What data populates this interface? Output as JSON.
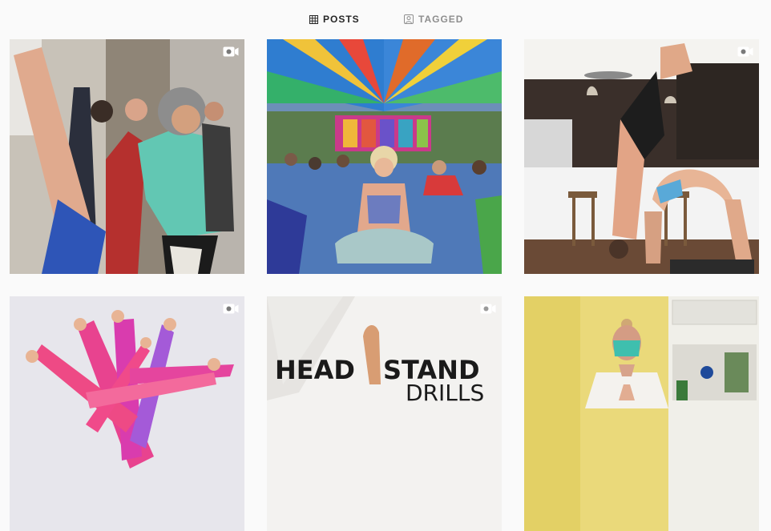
{
  "tabs": {
    "posts": {
      "label": "POSTS",
      "icon": "grid-icon",
      "active": true
    },
    "tagged": {
      "label": "TAGGED",
      "icon": "tagged-person-icon",
      "active": false
    }
  },
  "posts": [
    {
      "type": "video",
      "subject": "yoga class, older teacher assisting a student"
    },
    {
      "type": "image",
      "subject": "meditation under colorful tent"
    },
    {
      "type": "video",
      "subject": "handstand and backbend in a kitchen"
    },
    {
      "type": "video",
      "subject": "pink leggings legs in a pose"
    },
    {
      "type": "video",
      "subject": "headstand drills",
      "caption_line1": "HEAD",
      "caption_line2": "STAND",
      "caption_line3": "DRILLS"
    },
    {
      "type": "image",
      "subject": "woman in mask and lab coat with hands together"
    }
  ],
  "colors": {
    "active_text": "#262626",
    "inactive_text": "#8e8e8e",
    "background": "#fafafa"
  }
}
